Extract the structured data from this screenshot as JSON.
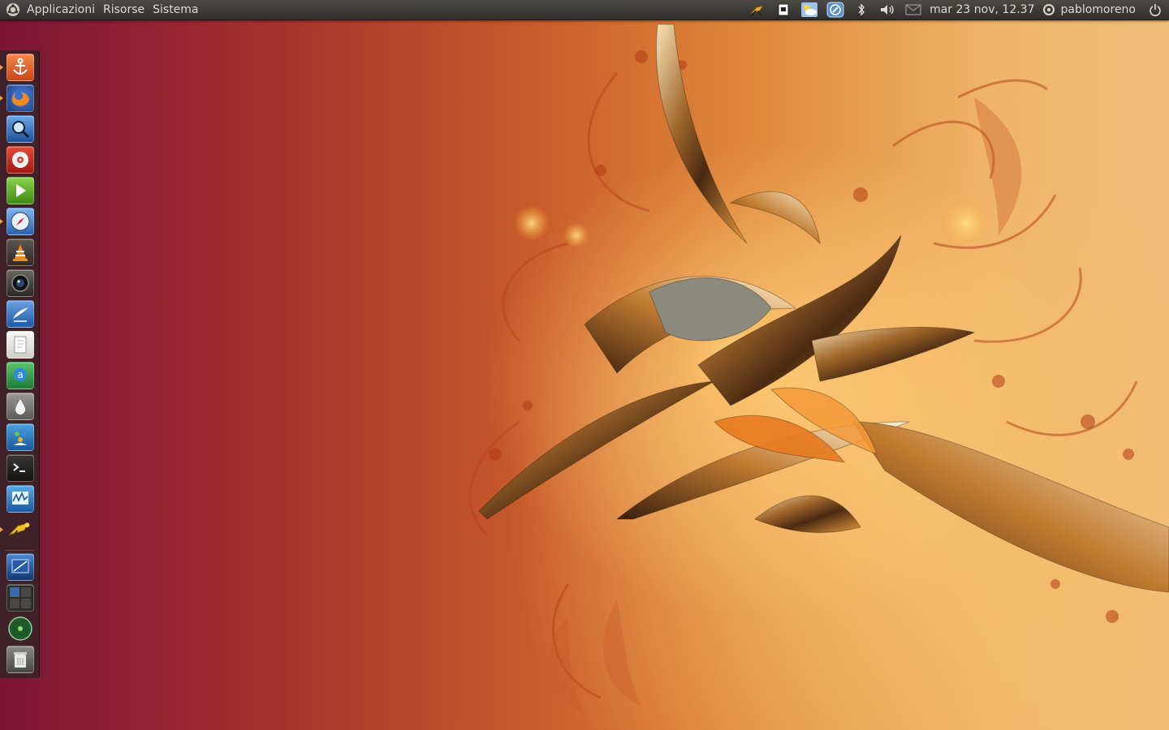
{
  "panel": {
    "menus": [
      "Applicazioni",
      "Risorse",
      "Sistema"
    ],
    "clock": "mar 23 nov, 12.37",
    "username": "pablomoreno",
    "tray_icons": [
      "grasshopper-icon",
      "clipboard-icon",
      "weather-icon",
      "network-icon",
      "bluetooth-icon",
      "volume-icon",
      "mail-icon"
    ]
  },
  "launcher": {
    "items": [
      {
        "name": "ubuntu-anchor-icon",
        "running": true
      },
      {
        "name": "firefox-icon",
        "running": true
      },
      {
        "name": "search-app-icon",
        "running": false
      },
      {
        "name": "cd-burner-icon",
        "running": false
      },
      {
        "name": "media-player-icon",
        "running": false
      },
      {
        "name": "safari-compass-icon",
        "running": true
      },
      {
        "name": "vlc-cone-icon",
        "running": false
      },
      {
        "name": "webcam-icon",
        "running": false
      },
      {
        "name": "writer-document-icon",
        "running": false
      },
      {
        "name": "text-editor-icon",
        "running": false
      },
      {
        "name": "amsn-chat-icon",
        "running": false
      },
      {
        "name": "droplet-app-icon",
        "running": false
      },
      {
        "name": "messenger-icon",
        "running": false
      },
      {
        "name": "terminal-icon",
        "running": false
      },
      {
        "name": "system-monitor-icon",
        "running": false
      },
      {
        "name": "grasshopper-app-icon",
        "running": true
      },
      {
        "name": "workspace-switcher-icon",
        "running": false
      },
      {
        "name": "workspaces-grid-icon",
        "running": false
      },
      {
        "name": "green-sphere-icon",
        "running": false
      },
      {
        "name": "trash-icon",
        "running": false
      }
    ]
  },
  "colors": {
    "accent": "#f39c4a",
    "panel": "#3b3a36",
    "wallpaper_left": "#7a1535",
    "wallpaper_right": "#f1bd78"
  }
}
